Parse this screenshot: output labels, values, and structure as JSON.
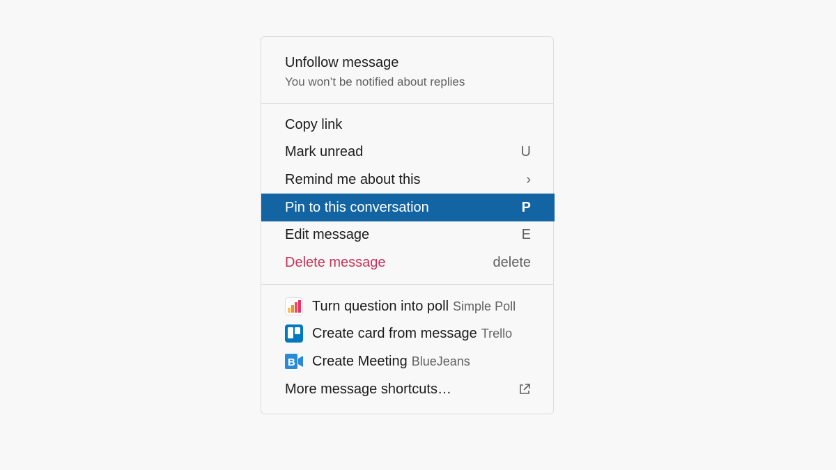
{
  "menu": {
    "unfollow": {
      "label": "Unfollow message",
      "sublabel": "You won’t be notified about replies"
    },
    "items": [
      {
        "label": "Copy link",
        "shortcut": ""
      },
      {
        "label": "Mark unread",
        "shortcut": "U"
      },
      {
        "label": "Remind me about this",
        "shortcut": "›"
      },
      {
        "label": "Pin to this conversation",
        "shortcut": "P"
      },
      {
        "label": "Edit message",
        "shortcut": "E"
      },
      {
        "label": "Delete message",
        "shortcut": "delete"
      }
    ],
    "shortcuts": [
      {
        "label": "Turn question into poll",
        "app": "Simple Poll",
        "icon": "simple-poll-icon"
      },
      {
        "label": "Create card from message",
        "app": "Trello",
        "icon": "trello-icon"
      },
      {
        "label": "Create Meeting",
        "app": "BlueJeans",
        "icon": "bluejeans-icon"
      }
    ],
    "more": {
      "label": "More message shortcuts…",
      "icon": "external-link-icon"
    }
  },
  "colors": {
    "highlight": "#1264a3",
    "danger": "#c5325c",
    "text": "#1d1c1d",
    "muted": "#616061"
  }
}
